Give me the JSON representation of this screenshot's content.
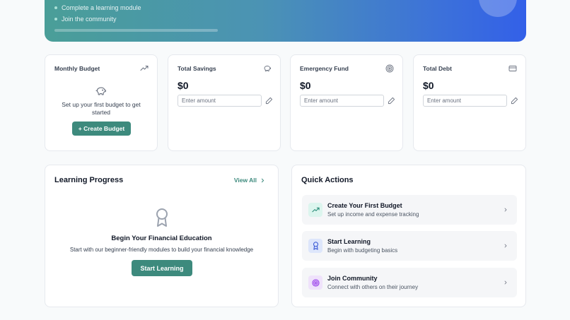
{
  "hero": {
    "checklist": [
      "Complete a learning module",
      "Join the community"
    ],
    "progress": 0
  },
  "stats": {
    "monthly_budget": {
      "title": "Monthly Budget",
      "icon": "trending-up-icon",
      "empty_text": "Set up your first budget to get started",
      "button_label": "+ Create Budget"
    },
    "total_savings": {
      "title": "Total Savings",
      "icon": "piggy-bank-icon",
      "value": "$0",
      "placeholder": "Enter amount"
    },
    "emergency_fund": {
      "title": "Emergency Fund",
      "icon": "target-icon",
      "value": "$0",
      "placeholder": "Enter amount"
    },
    "total_debt": {
      "title": "Total Debt",
      "icon": "credit-card-icon",
      "value": "$0",
      "placeholder": "Enter amount"
    }
  },
  "learning": {
    "title": "Learning Progress",
    "view_all": "View All",
    "empty_title": "Begin Your Financial Education",
    "empty_sub": "Start with our beginner-friendly modules to build your financial knowledge",
    "button_label": "Start Learning"
  },
  "quick_actions": {
    "title": "Quick Actions",
    "items": [
      {
        "title": "Create Your First Budget",
        "sub": "Set up income and expense tracking",
        "icon": "trending-up-icon",
        "icon_bg": "#dcf5ee",
        "icon_color": "#2f8f7c"
      },
      {
        "title": "Start Learning",
        "sub": "Begin with budgeting basics",
        "icon": "award-icon",
        "icon_bg": "#dde6fb",
        "icon_color": "#3b5bd6"
      },
      {
        "title": "Join Community",
        "sub": "Connect with others on their journey",
        "icon": "target-icon",
        "icon_bg": "#efe2fb",
        "icon_color": "#9333ea"
      }
    ]
  },
  "colors": {
    "accent": "#3d8a7d",
    "hero_start": "#4a9e98",
    "hero_end": "#3360e8"
  }
}
